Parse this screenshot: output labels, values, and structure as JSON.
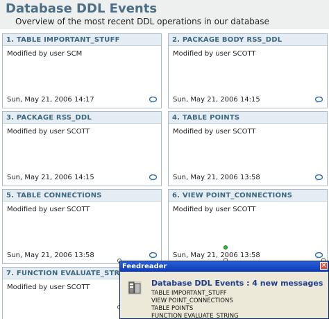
{
  "header": {
    "title": "Database DDL Events",
    "subtitle": "Overview of the most recent DDL operations in our database"
  },
  "cards": [
    {
      "title": "1. TABLE IMPORTANT_STUFF",
      "body": "Modified by user SCM",
      "date": "Sun, May 21, 2006 14:17"
    },
    {
      "title": "2. PACKAGE BODY RSS_DDL",
      "body": "Modified by user SCOTT",
      "date": "Sun, May 21, 2006 14:15"
    },
    {
      "title": "3. PACKAGE RSS_DDL",
      "body": "Modified by user SCOTT",
      "date": "Sun, May 21, 2006 14:15"
    },
    {
      "title": "4. TABLE POINTS",
      "body": "Modified by user SCOTT",
      "date": "Sun, May 21, 2006 13:58"
    },
    {
      "title": "5. TABLE CONNECTIONS",
      "body": "Modified by user SCOTT",
      "date": "Sun, May 21, 2006 13:58"
    },
    {
      "title": "6. VIEW POINT_CONNECTIONS",
      "body": "Modified by user SCOTT",
      "date": "Sun, May 21, 2006 13:58"
    },
    {
      "title": "7. FUNCTION EVALUATE_STRING",
      "body": "Modified by user SCOTT",
      "date": ""
    }
  ],
  "popup": {
    "window_title": "Feedreader",
    "close_glyph": "×",
    "heading": "Database DDL Events : 4 new messages",
    "lines": [
      "TABLE IMPORTANT_STUFF",
      "VIEW POINT_CONNECTIONS",
      "TABLE POINTS",
      "FUNCTION EVALUATE_STRING"
    ]
  },
  "icons": {
    "comment": "comment-bubble-icon",
    "feed": "feed-stack-icon",
    "close": "close-icon"
  },
  "colors": {
    "title": "#4a6f86",
    "card_border": "#a9bcc8",
    "card_head_bg": "#e6edf2",
    "popup_title_bg": "#0b3ab5",
    "popup_heading": "#1f3b8f"
  }
}
